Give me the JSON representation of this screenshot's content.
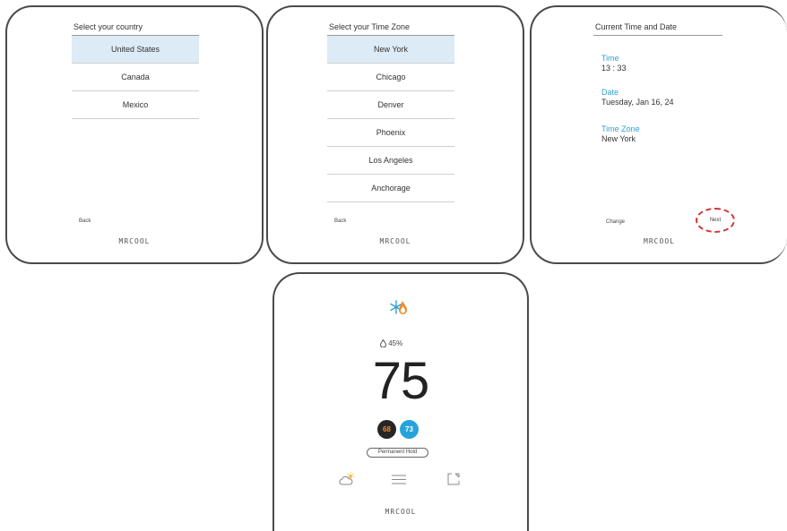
{
  "brand": "MRCOOL",
  "country_screen": {
    "title": "Select your country",
    "options": [
      "United States",
      "Canada",
      "Mexico"
    ],
    "selected": "United States",
    "back_label": "Back"
  },
  "timezone_screen": {
    "title": "Select your Time Zone",
    "options": [
      "New York",
      "Chicago",
      "Denver",
      "Phoenix",
      "Los Angeles",
      "Anchorage"
    ],
    "selected": "New York",
    "back_label": "Back"
  },
  "datetime_screen": {
    "title": "Current Time and Date",
    "time_label": "Time",
    "time_value": "13 : 33",
    "date_label": "Date",
    "date_value": "Tuesday, Jan 16, 24",
    "timezone_label": "Time Zone",
    "timezone_value": "New York",
    "change_label": "Change",
    "next_label": "Next"
  },
  "home_screen": {
    "mode_icon": "heat-cool-mode-icon",
    "humidity": "45%",
    "temperature": "75",
    "heat_setpoint": "68",
    "cool_setpoint": "73",
    "hold_label": "Permanent Hold",
    "bottom_icons": [
      "weather-icon",
      "menu-icon",
      "fan-icon"
    ]
  },
  "colors": {
    "accent_blue": "#2f9fd6",
    "selected_row": "#dcebf6",
    "heat_orange": "#f28a2a",
    "highlight_red": "#d0353a",
    "frame": "#4a4a4a"
  }
}
